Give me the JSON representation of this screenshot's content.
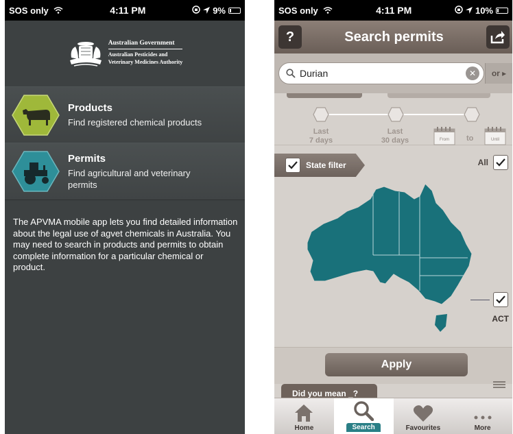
{
  "left": {
    "status": {
      "carrier": "SOS only",
      "time": "4:11 PM",
      "battery": "9%",
      "battery_level": 0.09
    },
    "header": {
      "line1": "Australian Government",
      "line2": "Australian Pesticides and",
      "line3": "Veterinary Medicines Authority"
    },
    "menu": [
      {
        "title": "Products",
        "subtitle": "Find registered chemical products",
        "icon": "cow-icon",
        "color": "#9fb83a"
      },
      {
        "title": "Permits",
        "subtitle": "Find agricultural and veterinary permits",
        "icon": "tractor-icon",
        "color": "#2e8f99"
      }
    ],
    "about": "The APVMA mobile app lets you find detailed information about the legal use of agvet chemicals in Australia. You may need to search in products and permits to obtain complete information for a particular chemical or product."
  },
  "right": {
    "status": {
      "carrier": "SOS only",
      "time": "4:11 PM",
      "battery": "10%",
      "battery_level": 0.1
    },
    "nav": {
      "help": "?",
      "title": "Search permits"
    },
    "search": {
      "value": "Durian",
      "or_label": "or ▸"
    },
    "timeline": {
      "label1": "Last",
      "label1b": "7 days",
      "label2": "Last",
      "label2b": "30 days",
      "from": "From",
      "to": "to",
      "until": "Until"
    },
    "filter": {
      "state_label": "State filter",
      "all_label": "All",
      "act_label": "ACT"
    },
    "apply_label": "Apply",
    "did_you_mean": "Did you mean _?",
    "tabs": [
      "Home",
      "Search",
      "Favourites",
      "More"
    ],
    "colors": {
      "map": "#19717a",
      "accent": "#2a7f86"
    }
  }
}
